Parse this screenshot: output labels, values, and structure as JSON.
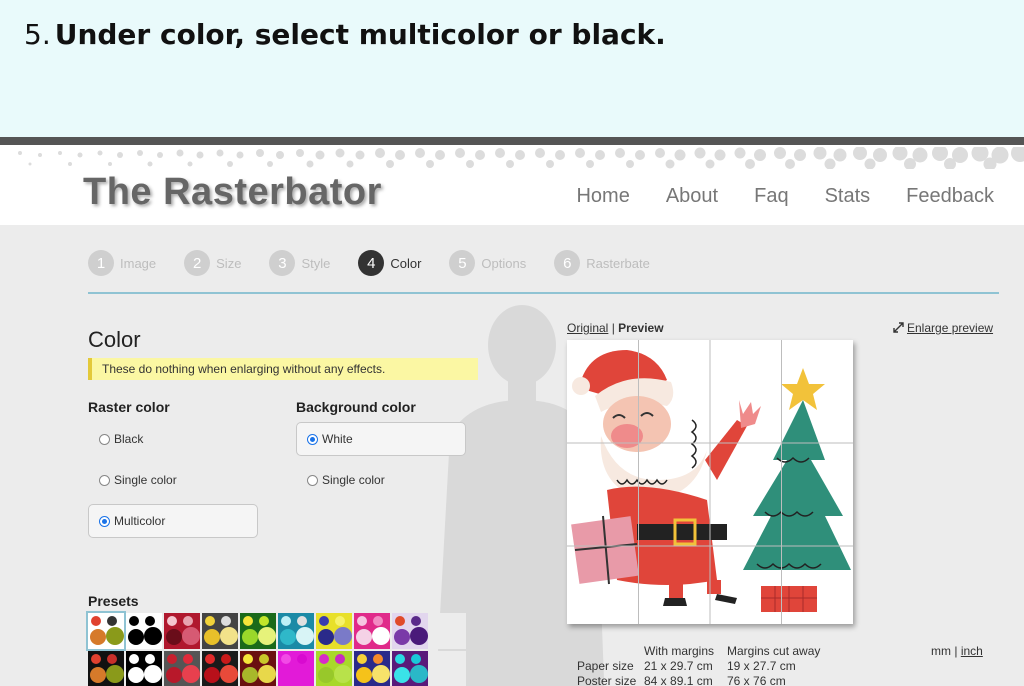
{
  "banner": {
    "step_number": "5.",
    "instruction": "Under color, select multicolor or black."
  },
  "header": {
    "logo": "The Rasterbator",
    "nav": [
      "Home",
      "About",
      "Faq",
      "Stats",
      "Feedback"
    ]
  },
  "steps": [
    {
      "num": "1",
      "label": "Image"
    },
    {
      "num": "2",
      "label": "Size"
    },
    {
      "num": "3",
      "label": "Style"
    },
    {
      "num": "4",
      "label": "Color"
    },
    {
      "num": "5",
      "label": "Options"
    },
    {
      "num": "6",
      "label": "Rasterbate"
    }
  ],
  "active_step": 4,
  "color_section": {
    "title": "Color",
    "note": "These do nothing when enlarging without any effects.",
    "raster_color": {
      "title": "Raster color",
      "options": [
        "Black",
        "Single color",
        "Multicolor"
      ],
      "selected": "Multicolor"
    },
    "background_color": {
      "title": "Background color",
      "options": [
        "White",
        "Single color"
      ],
      "selected": "White"
    },
    "presets_title": "Presets"
  },
  "preview": {
    "original_label": "Original",
    "separator": "|",
    "preview_label": "Preview",
    "enlarge_label": "Enlarge preview",
    "enlarge_icon": "expand-arrows-icon"
  },
  "stats": {
    "col_with_margins": "With margins",
    "col_margins_cut": "Margins cut away",
    "paper_size_label": "Paper size",
    "paper_with": "21 x 29.7 cm",
    "paper_cut": "19 x 27.7 cm",
    "poster_size_label": "Poster size",
    "poster_with": "84 x 89.1 cm",
    "poster_cut": "76 x 76 cm"
  },
  "units": {
    "mm": "mm",
    "sep": "|",
    "inch": "inch"
  },
  "colors": {
    "accent_line": "#8fc3d3",
    "note_bg": "#fbf7a3",
    "radio_selected": "#1a73e8",
    "banner_bg": "#e9fafb"
  }
}
